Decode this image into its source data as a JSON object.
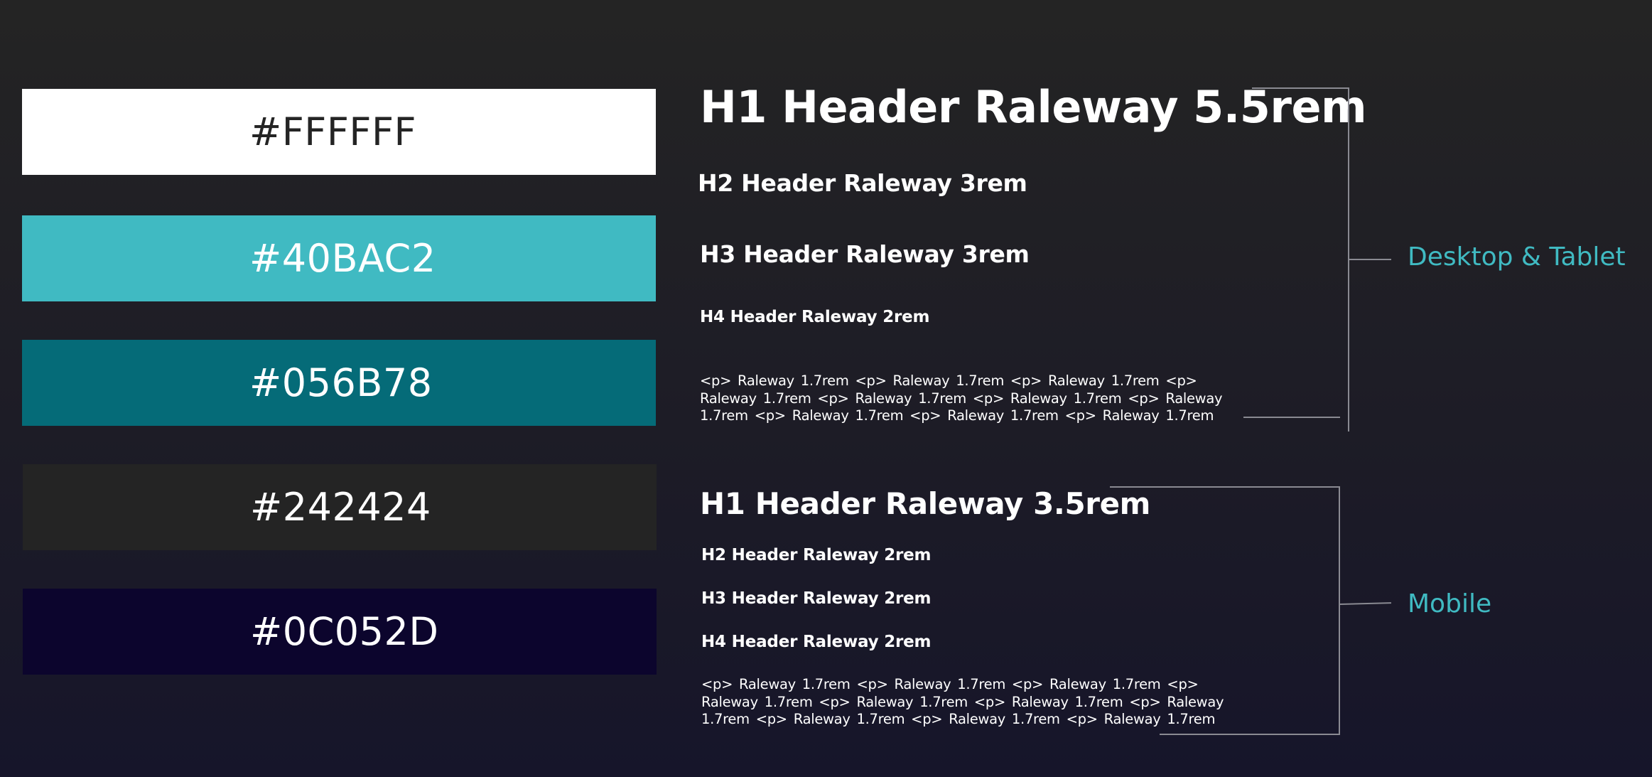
{
  "swatches": [
    {
      "hex": "#FFFFFF",
      "label": "#FFFFFF",
      "text_color": "#242424"
    },
    {
      "hex": "#40BAC2",
      "label": "#40BAC2",
      "text_color": "#FFFFFF"
    },
    {
      "hex": "#056B78",
      "label": "#056B78",
      "text_color": "#FFFFFF"
    },
    {
      "hex": "#242424",
      "label": "#242424",
      "text_color": "#FFFFFF"
    },
    {
      "hex": "#0C052D",
      "label": "#0C052D",
      "text_color": "#FFFFFF"
    }
  ],
  "desktop": {
    "label": "Desktop & Tablet",
    "h1": "H1 Header Raleway 5.5rem",
    "h2": "H2 Header Raleway 3rem",
    "h3": "H3 Header Raleway 3rem",
    "h4": "H4 Header Raleway 2rem",
    "paragraph": "<p> Raleway 1.7rem <p> Raleway 1.7rem <p> Raleway 1.7rem <p> Raleway 1.7rem <p> Raleway 1.7rem <p> Raleway 1.7rem <p> Raleway 1.7rem <p> Raleway 1.7rem <p> Raleway 1.7rem <p> Raleway 1.7rem"
  },
  "mobile": {
    "label": "Mobile",
    "h1": "H1 Header Raleway 3.5rem",
    "h2": "H2 Header Raleway 2rem",
    "h3": "H3 Header Raleway 2rem",
    "h4": "H4 Header Raleway 2rem",
    "paragraph": "<p> Raleway 1.7rem <p> Raleway 1.7rem <p> Raleway 1.7rem <p> Raleway 1.7rem <p> Raleway 1.7rem <p> Raleway 1.7rem <p> Raleway 1.7rem <p> Raleway 1.7rem <p> Raleway 1.7rem <p> Raleway 1.7rem"
  },
  "colors": {
    "accent": "#40BAC2",
    "bracket": "#8A8A92"
  }
}
